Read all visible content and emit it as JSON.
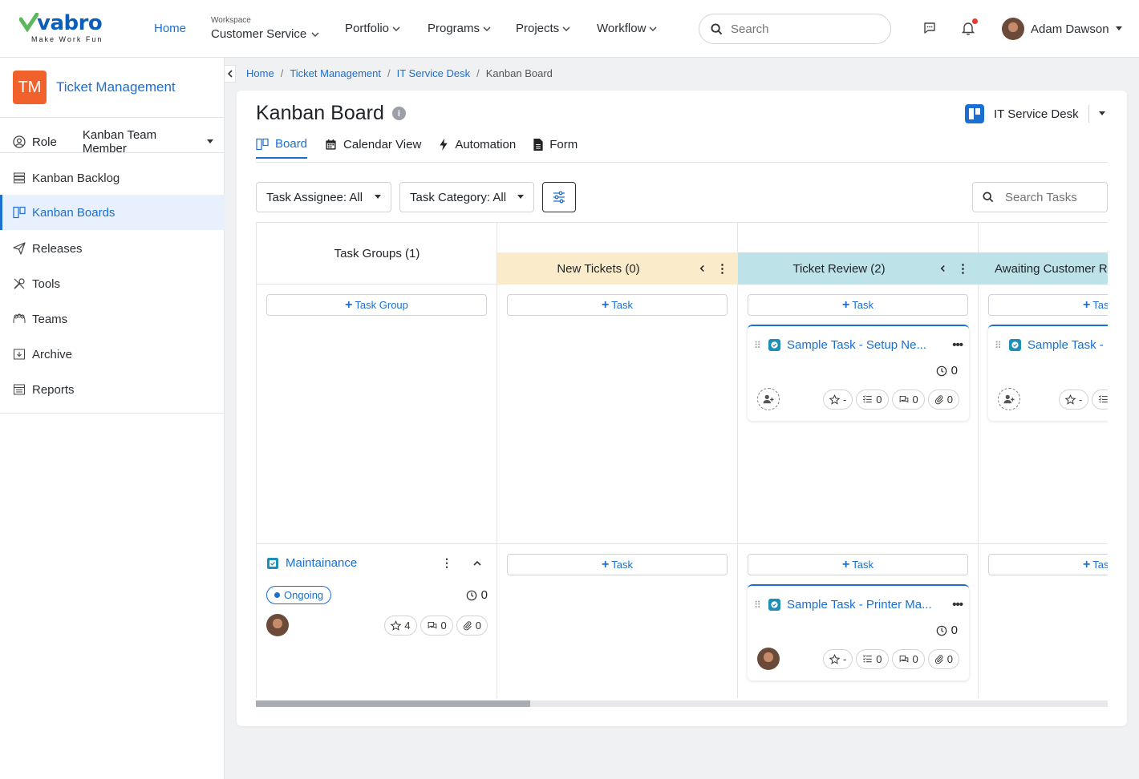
{
  "brand": {
    "name": "vabro",
    "tagline": "Make Work Fun"
  },
  "nav": {
    "home": "Home",
    "workspace_label": "Workspace",
    "workspace_value": "Customer Service",
    "portfolio": "Portfolio",
    "programs": "Programs",
    "projects": "Projects",
    "workflow": "Workflow"
  },
  "search": {
    "placeholder": "Search"
  },
  "user": {
    "name": "Adam Dawson"
  },
  "sidebar": {
    "project_badge": "TM",
    "project_name": "Ticket Management",
    "role_label": "Role",
    "role_value": "Kanban Team Member",
    "items": [
      {
        "label": "Kanban Backlog"
      },
      {
        "label": "Kanban Boards"
      },
      {
        "label": "Releases"
      },
      {
        "label": "Tools"
      },
      {
        "label": "Teams"
      },
      {
        "label": "Archive"
      },
      {
        "label": "Reports"
      }
    ]
  },
  "breadcrumb": [
    "Home",
    "Ticket Management",
    "IT Service Desk",
    "Kanban Board"
  ],
  "page": {
    "title": "Kanban Board",
    "board_name": "IT Service Desk"
  },
  "tabs": [
    {
      "label": "Board"
    },
    {
      "label": "Calendar View"
    },
    {
      "label": "Automation"
    },
    {
      "label": "Form"
    }
  ],
  "filters": {
    "assignee": "Task Assignee: All",
    "category": "Task Category: All",
    "search_placeholder": "Search Tasks"
  },
  "board": {
    "groups_header": "Task Groups (1)",
    "add_group": "Task Group",
    "add_task": "Task",
    "columns": [
      {
        "title": "New Tickets (0)",
        "color": "#faeccb"
      },
      {
        "title": "Ticket Review (2)",
        "color": "#bde3e8"
      },
      {
        "title": "Awaiting Customer R",
        "color": "#bde3e8"
      }
    ],
    "group": {
      "name": "Maintainance",
      "status": "Ongoing",
      "timer": "0",
      "stars": "4",
      "comments": "0",
      "attachments": "0"
    },
    "cards": [
      {
        "title": "Sample Task - Setup Ne...",
        "timer": "0",
        "rating": "-",
        "subtasks": "0",
        "comments": "0",
        "attachments": "0"
      },
      {
        "title": "Sample Task - Printer Ma...",
        "timer": "0",
        "rating": "-",
        "subtasks": "0",
        "comments": "0",
        "attachments": "0"
      },
      {
        "title": "Sample Task -",
        "rating": "-"
      }
    ]
  },
  "colors": {
    "accent": "#1b6fd1",
    "badge": "#f0612b",
    "new_col": "#faeccb",
    "review_col": "#bde3e8"
  }
}
